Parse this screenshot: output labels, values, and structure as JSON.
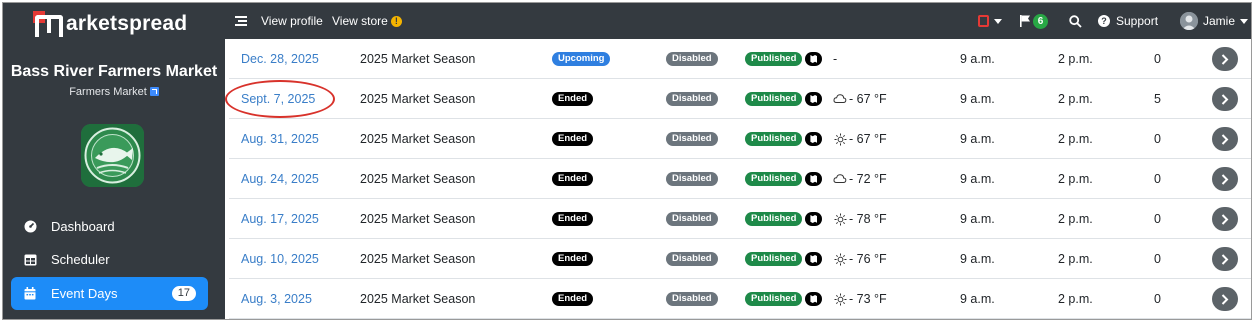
{
  "brand": {
    "logo_text": "arketspread"
  },
  "market": {
    "name": "Bass River Farmers Market",
    "type": "Farmers Market"
  },
  "nav": {
    "items": [
      {
        "label": "Dashboard",
        "icon": "dashboard-icon"
      },
      {
        "label": "Scheduler",
        "icon": "calendar-grid-icon"
      },
      {
        "label": "Event Days",
        "icon": "calendar-icon",
        "count": "17",
        "active": true
      }
    ]
  },
  "topbar": {
    "view_profile": "View profile",
    "view_store": "View store",
    "store_alert": "!",
    "flag_count": "6",
    "support": "Support",
    "user": "Jamie"
  },
  "events": [
    {
      "date": "Dec. 28, 2025",
      "season": "2025 Market Season",
      "status": "Upcoming",
      "store": "Disabled",
      "published": "Published",
      "weather_icon": "none",
      "weather": "-",
      "start": "9 a.m.",
      "end": "2 p.m.",
      "count": "0"
    },
    {
      "date": "Sept. 7, 2025",
      "season": "2025 Market Season",
      "status": "Ended",
      "store": "Disabled",
      "published": "Published",
      "weather_icon": "cloud-icon",
      "weather": "- 67 °F",
      "start": "9 a.m.",
      "end": "2 p.m.",
      "count": "5"
    },
    {
      "date": "Aug. 31, 2025",
      "season": "2025 Market Season",
      "status": "Ended",
      "store": "Disabled",
      "published": "Published",
      "weather_icon": "sun-icon",
      "weather": "- 67 °F",
      "start": "9 a.m.",
      "end": "2 p.m.",
      "count": "0"
    },
    {
      "date": "Aug. 24, 2025",
      "season": "2025 Market Season",
      "status": "Ended",
      "store": "Disabled",
      "published": "Published",
      "weather_icon": "cloud-icon",
      "weather": "- 72 °F",
      "start": "9 a.m.",
      "end": "2 p.m.",
      "count": "0"
    },
    {
      "date": "Aug. 17, 2025",
      "season": "2025 Market Season",
      "status": "Ended",
      "store": "Disabled",
      "published": "Published",
      "weather_icon": "sun-icon",
      "weather": "- 78 °F",
      "start": "9 a.m.",
      "end": "2 p.m.",
      "count": "0"
    },
    {
      "date": "Aug. 10, 2025",
      "season": "2025 Market Season",
      "status": "Ended",
      "store": "Disabled",
      "published": "Published",
      "weather_icon": "sun-icon",
      "weather": "- 76 °F",
      "start": "9 a.m.",
      "end": "2 p.m.",
      "count": "0"
    },
    {
      "date": "Aug. 3, 2025",
      "season": "2025 Market Season",
      "status": "Ended",
      "store": "Disabled",
      "published": "Published",
      "weather_icon": "sun-icon",
      "weather": "- 73 °F",
      "start": "9 a.m.",
      "end": "2 p.m.",
      "count": "0"
    }
  ],
  "colors": {
    "sidebar": "#343a40",
    "accent": "#1d8cf8",
    "link": "#3a7ec8",
    "published": "#1e8a49",
    "highlight": "#d8322b"
  }
}
